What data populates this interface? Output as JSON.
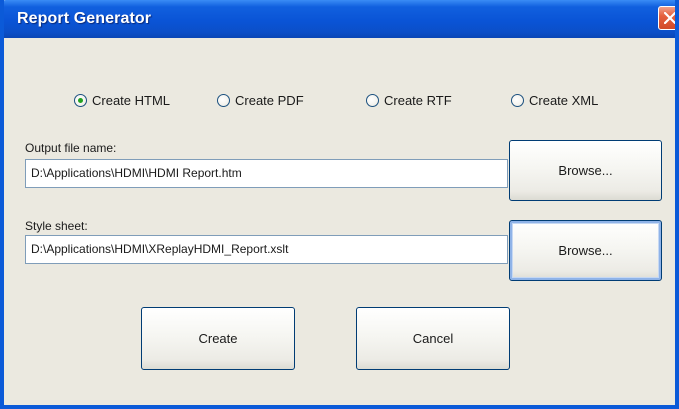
{
  "window": {
    "title": "Report Generator",
    "close_icon": "close-icon"
  },
  "format_options": [
    {
      "label": "Create HTML",
      "checked": true
    },
    {
      "label": "Create PDF",
      "checked": false
    },
    {
      "label": "Create RTF",
      "checked": false
    },
    {
      "label": "Create XML",
      "checked": false
    }
  ],
  "output_file": {
    "label": "Output file name:",
    "value": "D:\\Applications\\HDMI\\HDMI Report.htm",
    "browse_label": "Browse..."
  },
  "style_sheet": {
    "label": "Style sheet:",
    "value": "D:\\Applications\\HDMI\\XReplayHDMI_Report.xslt",
    "browse_label": "Browse..."
  },
  "actions": {
    "create_label": "Create",
    "cancel_label": "Cancel"
  },
  "colors": {
    "titlebar": "#0a54d6",
    "dialog_bg": "#ebe9e0",
    "close_button": "#e5603e",
    "radio_checked": "#21a121"
  }
}
